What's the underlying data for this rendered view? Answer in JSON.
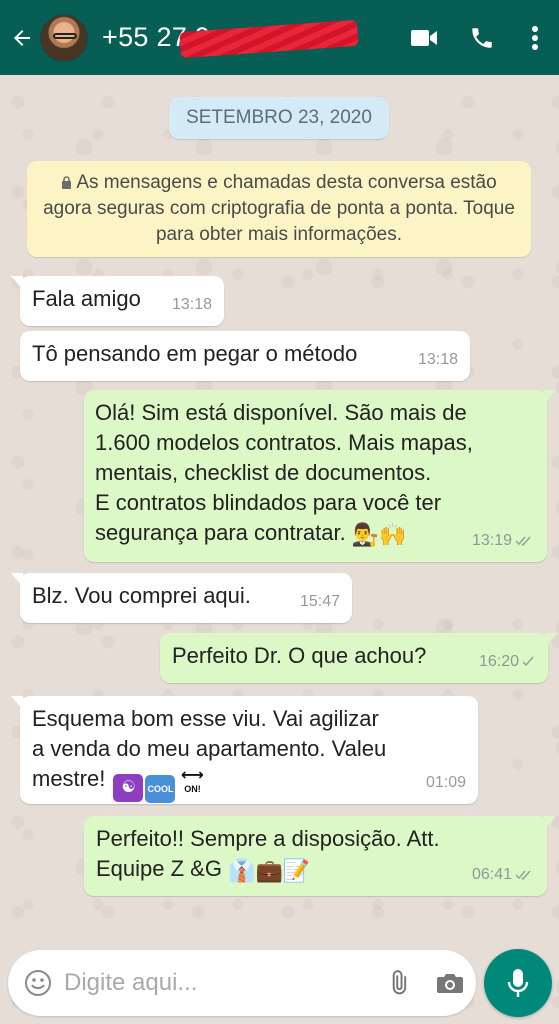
{
  "header": {
    "contact": "+55 27 9",
    "icons": [
      "back-arrow-icon",
      "video-call-icon",
      "phone-call-icon",
      "more-options-icon"
    ]
  },
  "date_chip": "SETEMBRO 23, 2020",
  "encryption_notice": "As mensagens e chamadas desta conversa estão agora seguras com criptografia de ponta a ponta. Toque para obter mais informações.",
  "messages": [
    {
      "dir": "in",
      "text": "Fala amigo",
      "time": "13:18"
    },
    {
      "dir": "in",
      "text": "Tô pensando em pegar o método",
      "time": "13:18"
    },
    {
      "dir": "out",
      "lines": [
        "Olá! Sim está disponível. São mais de",
        "1.600 modelos contratos. Mais mapas,",
        "mentais, checklist de documentos.",
        "E contratos blindados para você ter",
        "segurança para contratar."
      ],
      "time": "13:19",
      "status": "read"
    },
    {
      "dir": "in",
      "text": "Blz. Vou comprei aqui.",
      "time": "15:47"
    },
    {
      "dir": "out",
      "text": "Perfeito Dr. O que achou?",
      "time": "16:20",
      "status": "sent"
    },
    {
      "dir": "in",
      "lines": [
        "Esquema bom esse viu. Vai agilizar",
        "a venda do meu apartamento. Valeu",
        "mestre!"
      ],
      "time": "01:09"
    },
    {
      "dir": "out",
      "lines": [
        "Perfeito!! Sempre a disposição. Att.",
        "Equipe Z &G"
      ],
      "time": "06:41",
      "status": "read"
    }
  ],
  "emoji_labels": {
    "cool": "COOL",
    "on": "ON!"
  },
  "input": {
    "placeholder": "Digite aqui..."
  },
  "colors": {
    "header": "#075e54",
    "outgoing": "#dcf8c6",
    "incoming": "#ffffff",
    "mic": "#00897b",
    "notice": "#fdf4c5"
  }
}
